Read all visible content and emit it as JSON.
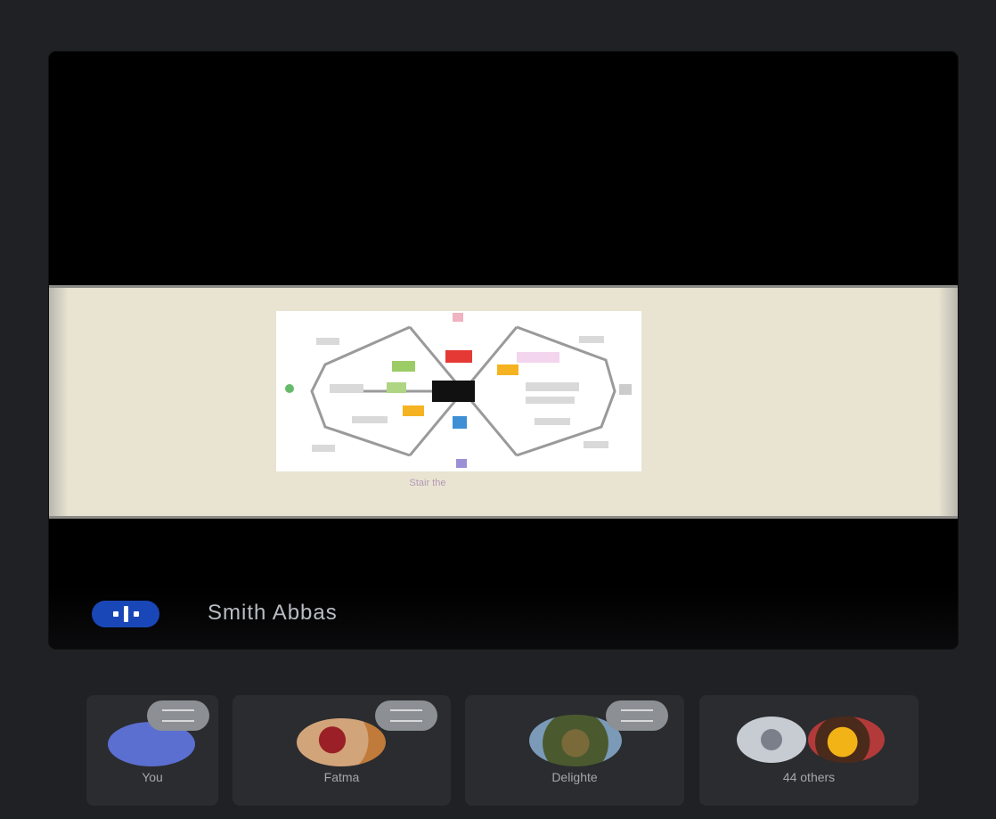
{
  "presentation": {
    "presenter_name": "Smith Abbas",
    "present_icon": "presentation-icon",
    "slide": {
      "caption": "Stair the"
    }
  },
  "participants": [
    {
      "label": "You",
      "icon": "user-avatar"
    },
    {
      "label": "Fatma",
      "icon": "user-avatar"
    },
    {
      "label": "Delighte",
      "icon": "user-avatar"
    },
    {
      "label": "44 others",
      "icon": "group-avatars"
    }
  ],
  "colors": {
    "background": "#202124",
    "tile": "#2b2c2f",
    "present_icon": "#1a47b8",
    "slide_band": "#e9e4d2"
  }
}
